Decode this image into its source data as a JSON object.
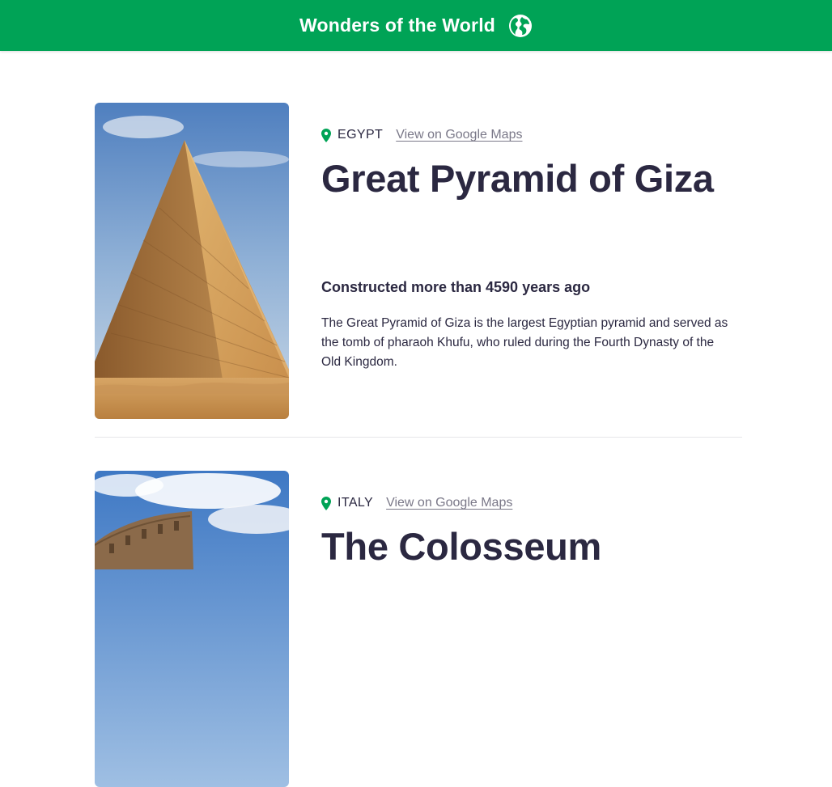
{
  "header": {
    "title": "Wonders of the World",
    "icon": "globe-icon",
    "background": "#00a356"
  },
  "accent_color": "#00a356",
  "entries": [
    {
      "country": "EGYPT",
      "maps_link": "View on Google Maps",
      "title": "Great Pyramid of Giza",
      "age": "Constructed more than 4590 years ago",
      "description": "The Great Pyramid of Giza is the largest Egyptian pyramid and served as the tomb of pharaoh Khufu, who ruled during the Fourth Dynasty of the Old Kingdom.",
      "icon": "map-pin-icon"
    },
    {
      "country": "ITALY",
      "maps_link": "View on Google Maps",
      "title": "The Colosseum",
      "icon": "map-pin-icon"
    }
  ]
}
